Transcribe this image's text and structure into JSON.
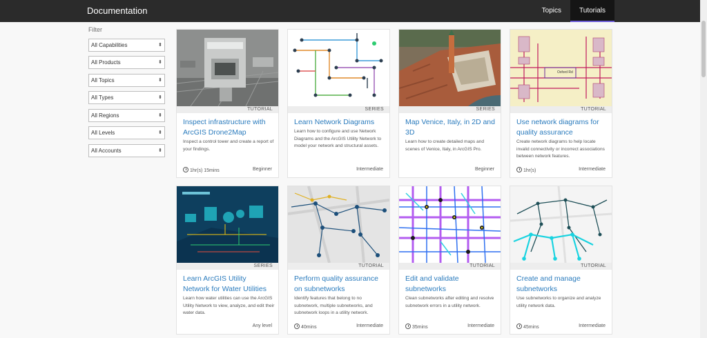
{
  "header": {
    "brand": "Documentation",
    "nav": [
      {
        "label": "Topics",
        "active": false
      },
      {
        "label": "Tutorials",
        "active": true
      }
    ]
  },
  "filters": {
    "title": "Filter",
    "selects": [
      "All Capabilities",
      "All Products",
      "All Topics",
      "All Types",
      "All Regions",
      "All Levels",
      "All Accounts"
    ]
  },
  "cards": [
    {
      "type": "TUTORIAL",
      "title": "Inspect infrastructure with ArcGIS Drone2Map",
      "description": "Inspect a control tower and create a report of your findings.",
      "duration": "1hr(s) 15mins",
      "level": "Beginner",
      "thumb_icon": "drone-photo-icon"
    },
    {
      "type": "SERIES",
      "title": "Learn Network Diagrams",
      "description": "Learn how to configure and use Network Diagrams and the ArcGIS Utility Network to model your network and structural assets.",
      "duration": "",
      "level": "Intermediate",
      "thumb_icon": "network-diagram-icon"
    },
    {
      "type": "SERIES",
      "title": "Map Venice, Italy, in 2D and 3D",
      "description": "Learn how to create detailed maps and scenes of Venice, Italy, in ArcGIS Pro.",
      "duration": "",
      "level": "Beginner",
      "thumb_icon": "venice-scene-icon"
    },
    {
      "type": "TUTORIAL",
      "title": "Use network diagrams for quality assurance",
      "description": "Create network diagrams to help locate invalid connectivity or incorrect associations between network features.",
      "duration": "1hr(s)",
      "level": "Intermediate",
      "thumb_icon": "qa-diagram-icon"
    },
    {
      "type": "SERIES",
      "title": "Learn ArcGIS Utility Network for Water Utilities",
      "description": "Learn how water utilities can use the ArcGIS Utility Network to view, analyze, and edit their water data.",
      "duration": "",
      "level": "Any level",
      "thumb_icon": "water-system-icon"
    },
    {
      "type": "TUTORIAL",
      "title": "Perform quality assurance on subnetworks",
      "description": "Identify features that belong to no subnetwork, multiple subnetworks, and subnetwork loops in a utility network.",
      "duration": "40mins",
      "level": "Intermediate",
      "thumb_icon": "subnetwork-map-icon"
    },
    {
      "type": "TUTORIAL",
      "title": "Edit and validate subnetworks",
      "description": "Clean subnetworks after editing and resolve subnetwork errors in a utility network.",
      "duration": "35mins",
      "level": "Intermediate",
      "thumb_icon": "subnetwork-errors-icon"
    },
    {
      "type": "TUTORIAL",
      "title": "Create and manage subnetworks",
      "description": "Use subnetworks to organize and analyze utility network data.",
      "duration": "45mins",
      "level": "Intermediate",
      "thumb_icon": "subnetwork-create-icon"
    }
  ]
}
